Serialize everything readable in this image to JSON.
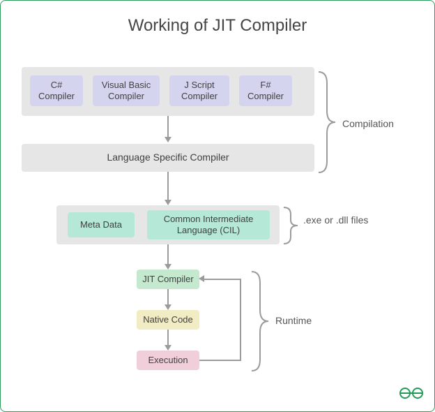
{
  "title": "Working of JIT Compiler",
  "compilers_row": [
    "C# Compiler",
    "Visual Basic Compiler",
    "J Script Compiler",
    "F# Compiler"
  ],
  "language_specific": "Language Specific Compiler",
  "cil_row": {
    "meta": "Meta Data",
    "cil": "Common Intermediate Language (CIL)"
  },
  "runtime": {
    "jit": "JIT Compiler",
    "native": "Native Code",
    "exec": "Execution"
  },
  "side": {
    "compilation": "Compilation",
    "files": ".exe or .dll files",
    "runtime": "Runtime"
  },
  "colors": {
    "frame_border": "#2d9c5b",
    "grey": "#e6e6e6",
    "lavender": "#d5d4ef",
    "mint": "#b5e8d6",
    "green": "#c4e9cf",
    "yellow": "#f2ecc4",
    "pink": "#f0cfdb",
    "arrow": "#9b9b9b"
  },
  "logo_text": "GG"
}
